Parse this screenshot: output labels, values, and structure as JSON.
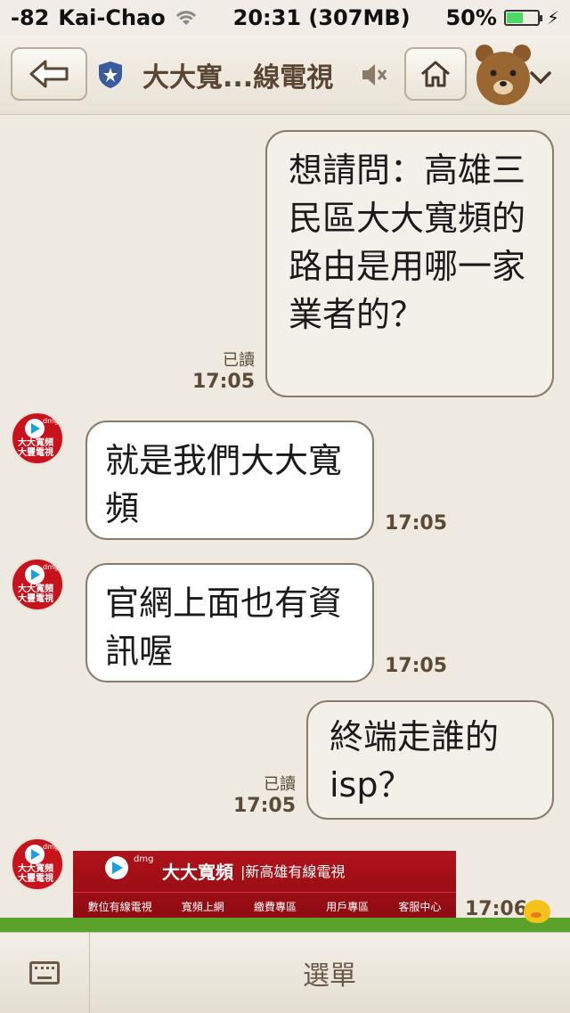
{
  "status_bar": {
    "signal": "-82",
    "carrier": "Kai-Chao",
    "time_memory": "20:31 (307MB)",
    "battery_percent": "50%",
    "battery_level": 0.5
  },
  "header": {
    "title": "大大寬...線電視"
  },
  "messages": [
    {
      "direction": "out",
      "text": "想請問：高雄三民區大大寬頻的路由是用哪一家業者的？",
      "read": "已讀",
      "time": "17:05"
    },
    {
      "direction": "in",
      "text": "就是我們大大寬頻",
      "time": "17:05"
    },
    {
      "direction": "in",
      "text": "官網上面也有資訊喔",
      "time": "17:05"
    },
    {
      "direction": "out",
      "text": "終端走誰的isp？",
      "read": "已讀",
      "time": "17:05"
    },
    {
      "direction": "in",
      "type": "banner",
      "time": "17:06"
    }
  ],
  "avatar": {
    "label_1": "大大寬頻",
    "label_2": "大豐電視",
    "dmg": "dmg"
  },
  "banner": {
    "dmg": "dmg",
    "brand": "大大寬頻",
    "subtitle": "新高雄有線電視",
    "nav": [
      "數位有線電視",
      "寬頻上網",
      "繳費專區",
      "用戶專區",
      "客服中心"
    ]
  },
  "bottom_bar": {
    "menu_label": "選單"
  }
}
